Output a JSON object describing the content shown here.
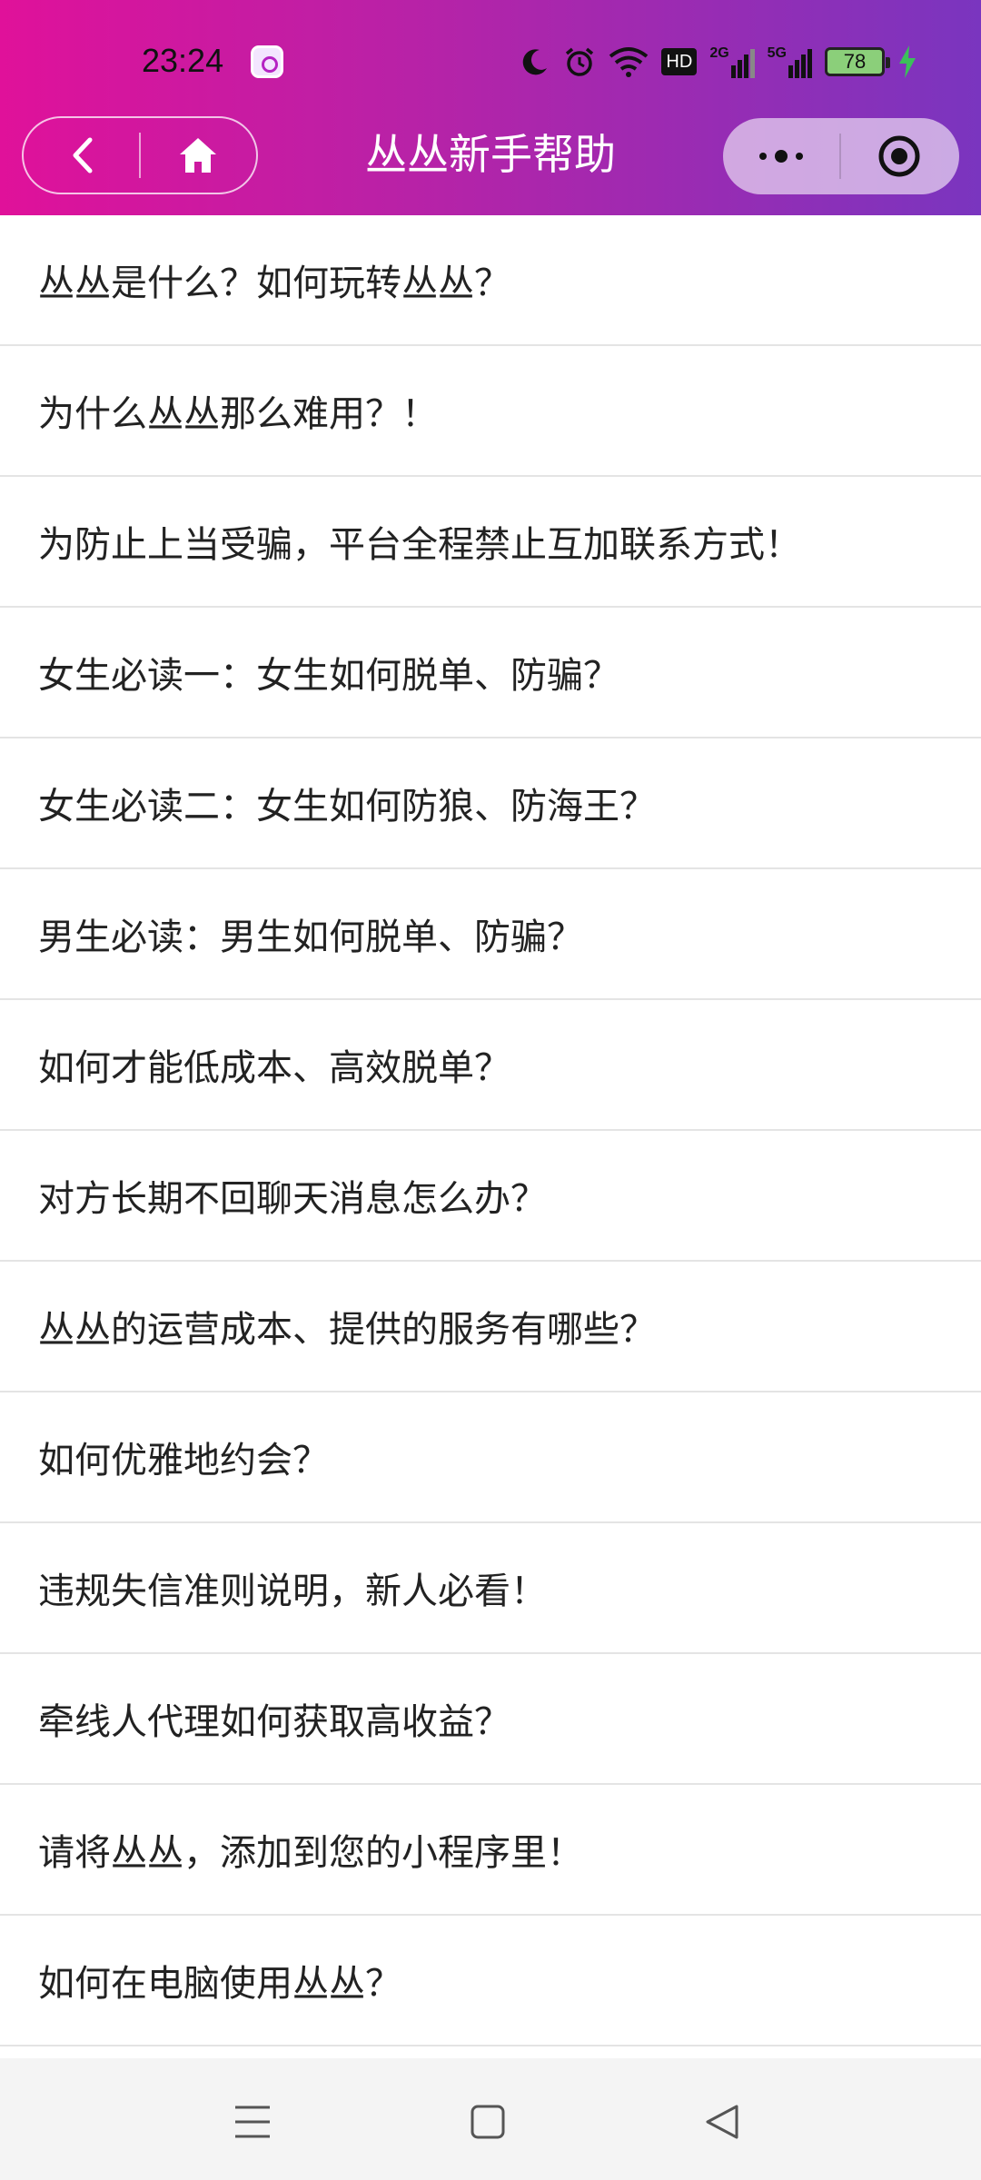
{
  "status_bar": {
    "time": "23:24",
    "battery_level": "78",
    "network_2g": "2G",
    "network_5g": "5G",
    "hd_badge": "HD"
  },
  "nav": {
    "title": "丛丛新手帮助"
  },
  "colors": {
    "header_gradient_start": "#e0119a",
    "header_gradient_end": "#7a35bf",
    "text": "#222222",
    "divider": "#e4e4e4"
  },
  "help_items": [
    "丛丛是什么？如何玩转丛丛？",
    "为什么丛丛那么难用？！",
    "为防止上当受骗，平台全程禁止互加联系方式！",
    "女生必读一：女生如何脱单、防骗？",
    "女生必读二：女生如何防狼、防海王？",
    "男生必读：男生如何脱单、防骗？",
    "如何才能低成本、高效脱单？",
    "对方长期不回聊天消息怎么办？",
    "丛丛的运营成本、提供的服务有哪些？",
    "如何优雅地约会？",
    "违规失信准则说明，新人必看！",
    "牵线人代理如何获取高收益？",
    "请将丛丛，添加到您的小程序里！",
    "如何在电脑使用丛丛？"
  ]
}
